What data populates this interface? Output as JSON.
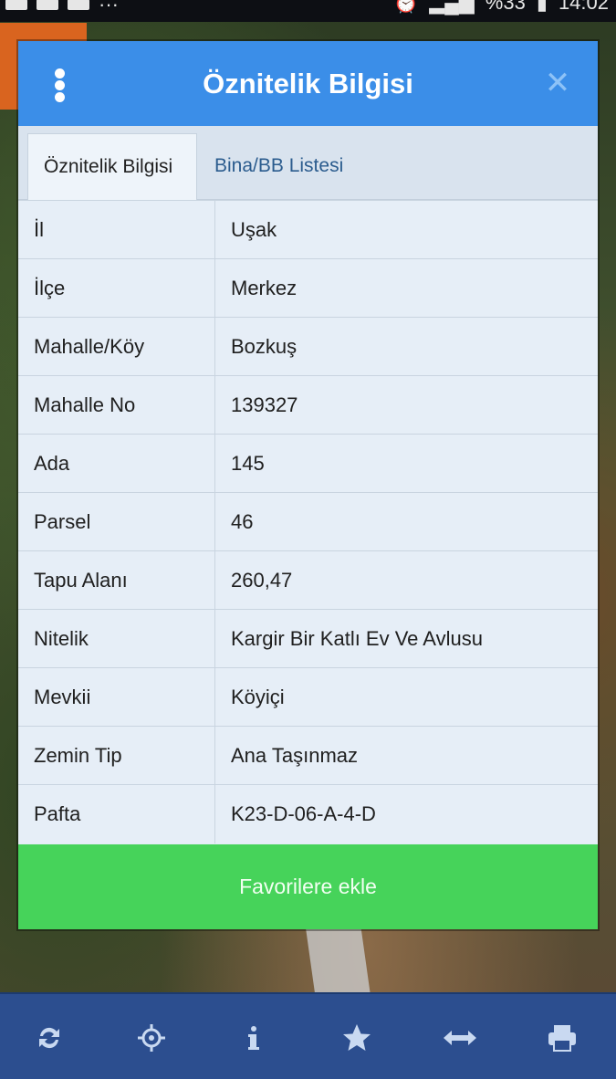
{
  "status_bar": {
    "dots": "···",
    "battery": "%33",
    "time": "14:02"
  },
  "dialog": {
    "title": "Öznitelik Bilgisi",
    "menu_icon": "vertical-dots-icon",
    "close_icon": "close-icon",
    "tabs": [
      {
        "label": "Öznitelik Bilgisi",
        "active": true
      },
      {
        "label": "Bina/BB Listesi",
        "active": false
      }
    ],
    "rows": [
      {
        "label": "İl",
        "value": "Uşak"
      },
      {
        "label": "İlçe",
        "value": "Merkez"
      },
      {
        "label": "Mahalle/Köy",
        "value": "Bozkuş"
      },
      {
        "label": "Mahalle No",
        "value": "139327"
      },
      {
        "label": "Ada",
        "value": "145"
      },
      {
        "label": "Parsel",
        "value": "46"
      },
      {
        "label": "Tapu Alanı",
        "value": "260,47"
      },
      {
        "label": "Nitelik",
        "value": "Kargir Bir Katlı Ev Ve Avlusu"
      },
      {
        "label": "Mevkii",
        "value": "Köyiçi"
      },
      {
        "label": "Zemin Tip",
        "value": "Ana Taşınmaz"
      },
      {
        "label": "Pafta",
        "value": "K23-D-06-A-4-D"
      }
    ],
    "favorite_button": "Favorilere ekle"
  },
  "toolbar": {
    "items": [
      "refresh-icon",
      "locate-icon",
      "info-icon",
      "star-icon",
      "resize-arrows-icon",
      "print-icon"
    ]
  },
  "colors": {
    "header": "#3b8ee8",
    "favorite": "#46d35a",
    "toolbar": "#2c4e8f"
  }
}
